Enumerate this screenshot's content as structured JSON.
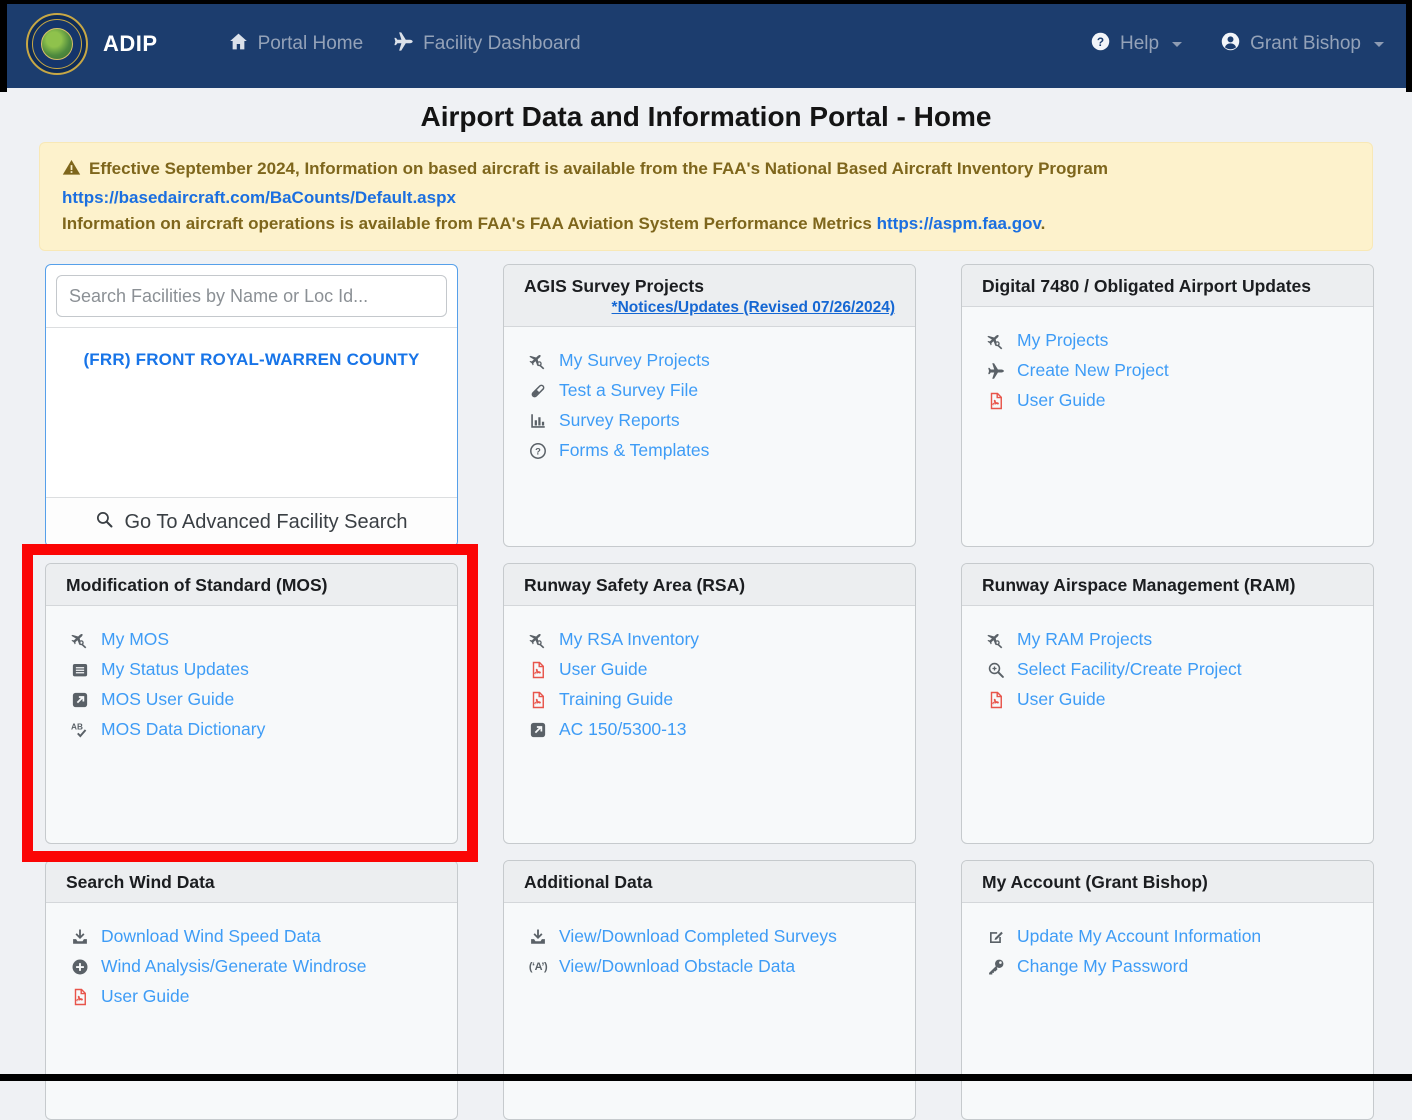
{
  "navbar": {
    "brand": "ADIP",
    "links": [
      {
        "icon": "home-icon",
        "label": "Portal Home"
      },
      {
        "icon": "plane-icon",
        "label": "Facility Dashboard"
      }
    ],
    "right_links": [
      {
        "icon": "help-circle-icon",
        "label": "Help"
      },
      {
        "icon": "user-circle-icon",
        "label": "Grant Bishop"
      }
    ]
  },
  "page_title": "Airport Data and Information Portal - Home",
  "alert": {
    "heading": "Effective September 2024, Information on based aircraft is available from the FAA's National Based Aircraft Inventory Program",
    "link1": "https://basedaircraft.com/BaCounts/Default.aspx",
    "line2": "Information on aircraft operations is available from FAA's FAA Aviation System Performance Metrics",
    "link2": "https://aspm.faa.gov",
    "line2_suffix": "."
  },
  "facility_search": {
    "placeholder": "Search Facilities by Name or Loc Id...",
    "result": "(FRR) FRONT ROYAL-WARREN COUNTY",
    "advanced_label": "Go To Advanced Facility Search"
  },
  "cards": [
    {
      "key": "agis",
      "title": "AGIS Survey Projects",
      "subtitle_link": "*Notices/Updates (Revised 07/26/2024)",
      "links": [
        {
          "icon": "plane-tools-icon",
          "label": "My Survey Projects"
        },
        {
          "icon": "vial-icon",
          "label": "Test a Survey File"
        },
        {
          "icon": "bar-chart-icon",
          "label": "Survey Reports"
        },
        {
          "icon": "question-circle-icon",
          "label": "Forms & Templates"
        }
      ]
    },
    {
      "key": "digital7480",
      "title": "Digital 7480 / Obligated Airport Updates",
      "links": [
        {
          "icon": "plane-tools-icon",
          "label": "My Projects"
        },
        {
          "icon": "plane-icon",
          "label": "Create New Project"
        },
        {
          "icon": "pdf-icon",
          "label": "User Guide"
        }
      ]
    },
    {
      "key": "mos",
      "title": "Modification of Standard (MOS)",
      "highlighted": true,
      "links": [
        {
          "icon": "plane-tools-icon",
          "label": "My MOS"
        },
        {
          "icon": "list-icon",
          "label": "My Status Updates"
        },
        {
          "icon": "external-link-icon",
          "label": "MOS User Guide"
        },
        {
          "icon": "spellcheck-icon",
          "label": "MOS Data Dictionary"
        }
      ]
    },
    {
      "key": "rsa",
      "title": "Runway Safety Area (RSA)",
      "links": [
        {
          "icon": "plane-tools-icon",
          "label": "My RSA Inventory"
        },
        {
          "icon": "pdf-icon",
          "label": "User Guide"
        },
        {
          "icon": "pdf-icon",
          "label": "Training Guide"
        },
        {
          "icon": "external-link-icon",
          "label": "AC 150/5300-13"
        }
      ]
    },
    {
      "key": "ram",
      "title": "Runway Airspace Management (RAM)",
      "links": [
        {
          "icon": "plane-tools-icon",
          "label": "My RAM Projects"
        },
        {
          "icon": "search-plus-icon",
          "label": "Select Facility/Create Project"
        },
        {
          "icon": "pdf-icon",
          "label": "User Guide"
        }
      ]
    },
    {
      "key": "wind",
      "title": "Search Wind Data",
      "links": [
        {
          "icon": "download-icon",
          "label": "Download Wind Speed Data"
        },
        {
          "icon": "plus-circle-icon",
          "label": "Wind Analysis/Generate Windrose"
        },
        {
          "icon": "pdf-icon",
          "label": "User Guide"
        }
      ]
    },
    {
      "key": "additional",
      "title": "Additional Data",
      "links": [
        {
          "icon": "download-icon",
          "label": "View/Download Completed Surveys"
        },
        {
          "icon": "obstacle-icon",
          "label": "View/Download Obstacle Data"
        }
      ]
    },
    {
      "key": "account",
      "title": "My Account (Grant Bishop)",
      "links": [
        {
          "icon": "edit-icon",
          "label": "Update My Account Information"
        },
        {
          "icon": "key-icon",
          "label": "Change My Password"
        }
      ]
    }
  ],
  "colors": {
    "navbar_bg": "#1c3d6e",
    "link_blue": "#3e9cf6",
    "strong_link_blue": "#1673e0",
    "pdf_red": "#e8544a",
    "alert_bg": "#fdf2cc",
    "alert_text": "#7e661c",
    "highlight_red": "#fb0505",
    "search_card_border": "#56a0ea",
    "icon_gray": "#5a6167"
  }
}
